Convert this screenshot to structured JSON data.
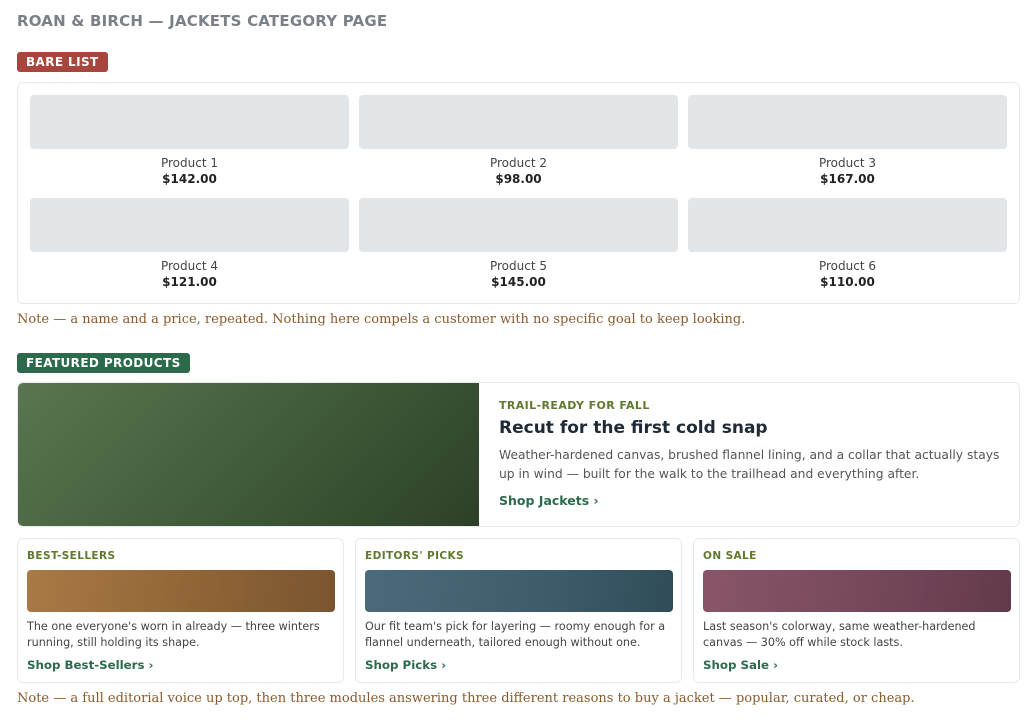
{
  "page": {
    "title": "ROAN & BIRCH — JACKETS CATEGORY PAGE"
  },
  "bare_list": {
    "badge": "BARE LIST",
    "products": [
      {
        "name": "Product 1",
        "price": "$142.00"
      },
      {
        "name": "Product 2",
        "price": "$98.00"
      },
      {
        "name": "Product 3",
        "price": "$167.00"
      },
      {
        "name": "Product 4",
        "price": "$121.00"
      },
      {
        "name": "Product 5",
        "price": "$145.00"
      },
      {
        "name": "Product 6",
        "price": "$110.00"
      }
    ],
    "note": "Note — a name and a price, repeated. Nothing here compels a customer with no specific goal to keep looking."
  },
  "featured": {
    "badge": "FEATURED PRODUCTS",
    "hero": {
      "eyebrow": "TRAIL-READY FOR FALL",
      "title": "Recut for the first cold snap",
      "description": "Weather-hardened canvas, brushed flannel lining, and a collar that actually stays up in wind — built for the walk to the trailhead and everything after.",
      "link": "Shop Jackets ›"
    },
    "modules": [
      {
        "eyebrow": "BEST-SELLERS",
        "description": "The one everyone's worn in already — three winters running, still holding its shape.",
        "link": "Shop Best-Sellers ›"
      },
      {
        "eyebrow": "EDITORS' PICKS",
        "description": "Our fit team's pick for layering — roomy enough for a flannel underneath, tailored enough without one.",
        "link": "Shop Picks ›"
      },
      {
        "eyebrow": "ON SALE",
        "description": "Last season's colorway, same weather-hardened canvas — 30% off while stock lasts.",
        "link": "Shop Sale ›"
      }
    ],
    "note": "Note — a full editorial voice up top, then three modules answering three different reasons to buy a jacket — popular, curated, or cheap."
  },
  "colors": {
    "bare_badge": "#a8453c",
    "featured_badge": "#2c6a4c",
    "placeholder": "#e3e6e9",
    "hero_image": "#4a6442",
    "module_best_sellers": "#9b6f3d",
    "module_editors_picks": "#3f5f6e",
    "module_on_sale": "#7a4a5c",
    "note_text": "#8a5a2b",
    "link": "#2c6a4c"
  }
}
